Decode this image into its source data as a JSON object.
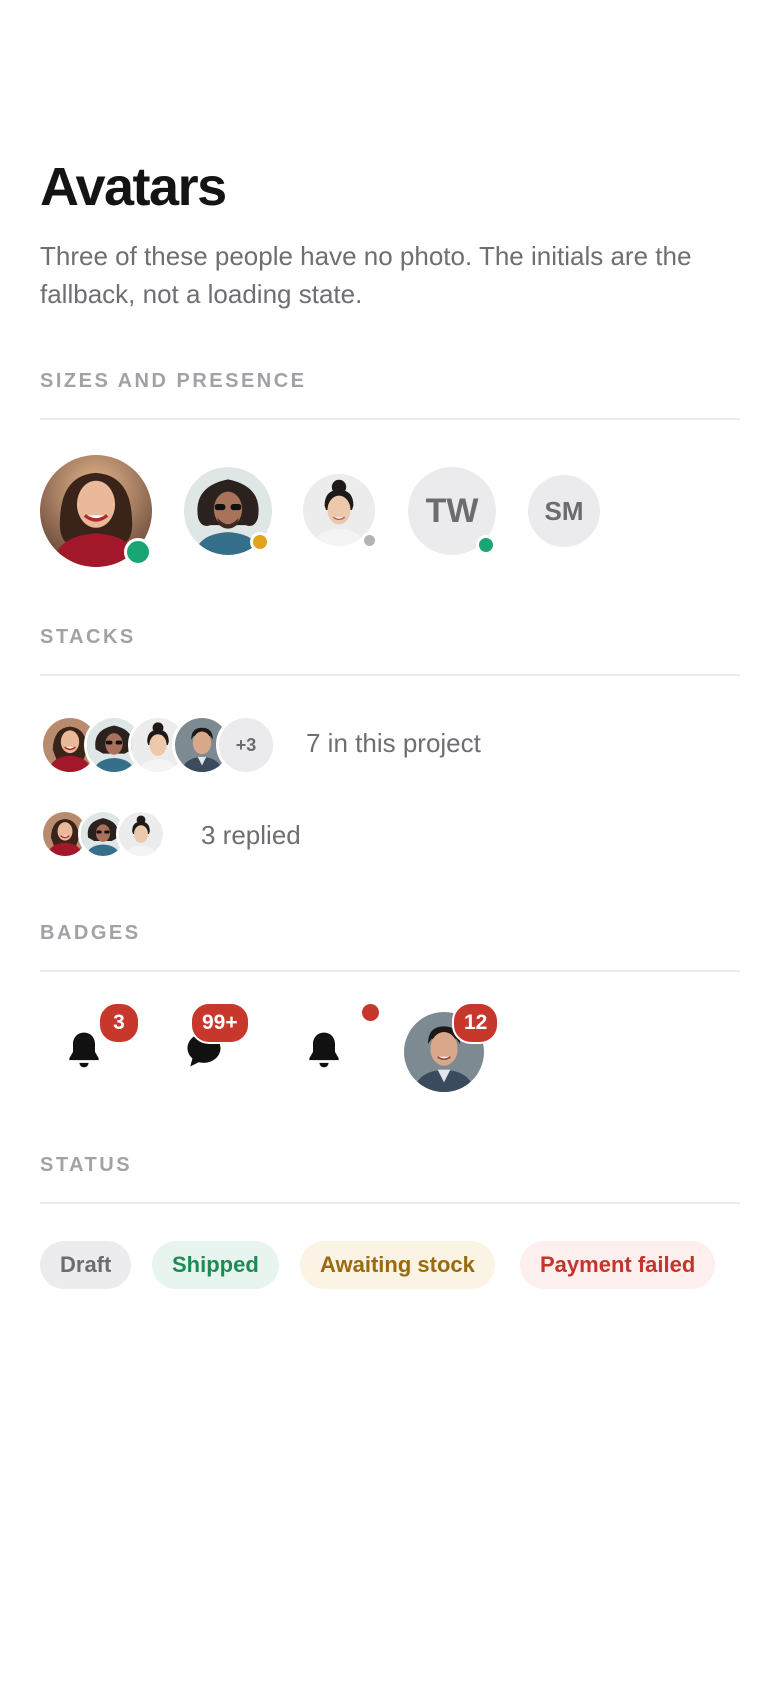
{
  "header": {
    "title": "Avatars",
    "intro": "Three of these people have no photo. The initials are the fallback, not a loading state."
  },
  "sections": {
    "sizes": "SIZES AND PRESENCE",
    "stacks": "STACKS",
    "badges": "BADGES",
    "status": "STATUS"
  },
  "presence_avatars": [
    {
      "kind": "photo",
      "person": "woman-red-sweater",
      "presence": "online",
      "presence_color": "#1aa672"
    },
    {
      "kind": "photo",
      "person": "man-sunglasses",
      "presence": "away",
      "presence_color": "#e0a31a"
    },
    {
      "kind": "photo",
      "person": "woman-bun",
      "presence": "offline",
      "presence_color": "#b3b3ba"
    },
    {
      "kind": "initials",
      "initials": "TW",
      "presence": "online",
      "presence_color": "#1aa672"
    },
    {
      "kind": "initials",
      "initials": "SM",
      "presence": "none"
    }
  ],
  "stacks": [
    {
      "people": [
        "woman-red-sweater",
        "man-sunglasses",
        "woman-bun",
        "man-suit"
      ],
      "more": "+3",
      "label": "7 in this project"
    },
    {
      "people": [
        "woman-red-sweater",
        "man-sunglasses",
        "woman-bun"
      ],
      "label": "3 replied"
    }
  ],
  "badges": [
    {
      "icon": "bell-icon",
      "count": "3"
    },
    {
      "icon": "chat-bubble-icon",
      "count": "99+"
    },
    {
      "icon": "bell-icon",
      "dot": true
    },
    {
      "icon": "avatar",
      "person": "man-suit",
      "count": "12"
    }
  ],
  "status_pills": [
    {
      "label": "Draft",
      "bg": "#ececef",
      "fg": "#6b6b72"
    },
    {
      "label": "Shipped",
      "bg": "#e8f5ee",
      "fg": "#1e8a55"
    },
    {
      "label": "Awaiting stock",
      "bg": "#fbf4e4",
      "fg": "#9a6a10"
    },
    {
      "label": "Payment failed",
      "bg": "#fcefee",
      "fg": "#c2352b"
    }
  ]
}
